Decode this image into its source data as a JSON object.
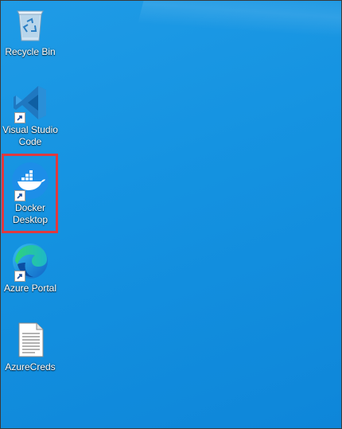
{
  "desktop": {
    "icons": [
      {
        "label": "Recycle Bin",
        "icon": "recycle-bin-icon",
        "shortcut": false
      },
      {
        "label": "Visual Studio Code",
        "icon": "vscode-icon",
        "shortcut": true
      },
      {
        "label": "Docker Desktop",
        "icon": "docker-icon",
        "shortcut": true,
        "highlighted": true
      },
      {
        "label": "Azure Portal",
        "icon": "edge-icon",
        "shortcut": true
      },
      {
        "label": "AzureCreds",
        "icon": "text-file-icon",
        "shortcut": false
      }
    ],
    "highlight_color": "#e0393e",
    "background_color": "#1593e1"
  }
}
